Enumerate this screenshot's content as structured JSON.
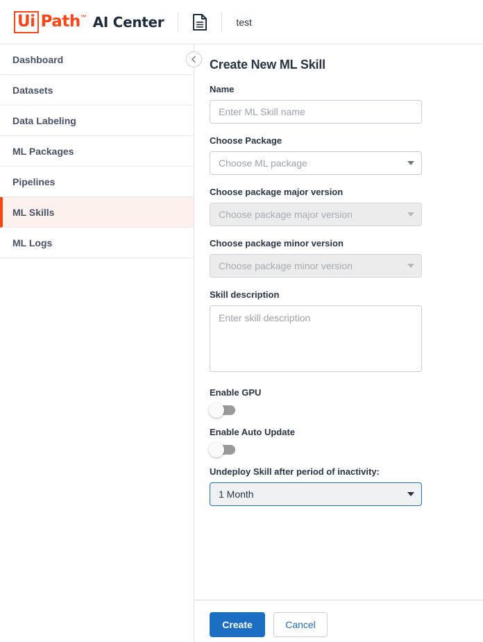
{
  "header": {
    "logo_ui": "Ui",
    "logo_path": "Path",
    "logo_tm": "™",
    "app_name": "AI Center",
    "doc_icon": "document-icon",
    "project_name": "test"
  },
  "sidebar": {
    "items": [
      {
        "label": "Dashboard",
        "active": false
      },
      {
        "label": "Datasets",
        "active": false
      },
      {
        "label": "Data Labeling",
        "active": false
      },
      {
        "label": "ML Packages",
        "active": false
      },
      {
        "label": "Pipelines",
        "active": false
      },
      {
        "label": "ML Skills",
        "active": true
      },
      {
        "label": "ML Logs",
        "active": false
      }
    ],
    "collapse_icon": "chevron-left-icon"
  },
  "main": {
    "title": "Create New ML Skill",
    "fields": {
      "name": {
        "label": "Name",
        "placeholder": "Enter ML Skill name",
        "value": ""
      },
      "package": {
        "label": "Choose Package",
        "placeholder": "Choose ML package",
        "value": ""
      },
      "major_version": {
        "label": "Choose package major version",
        "placeholder": "Choose package major version",
        "value": "",
        "disabled": true
      },
      "minor_version": {
        "label": "Choose package minor version",
        "placeholder": "Choose package minor version",
        "value": "",
        "disabled": true
      },
      "description": {
        "label": "Skill description",
        "placeholder": "Enter skill description",
        "value": ""
      },
      "enable_gpu": {
        "label": "Enable GPU",
        "state": "off"
      },
      "enable_auto_update": {
        "label": "Enable Auto Update",
        "state": "off"
      },
      "undeploy": {
        "label": "Undeploy Skill after period of inactivity:",
        "value": "1 Month"
      }
    },
    "footer": {
      "create_label": "Create",
      "cancel_label": "Cancel"
    }
  },
  "colors": {
    "brand_orange": "#FA4616",
    "primary_blue": "#1b6ec2",
    "active_bg": "#fdf1ed",
    "text_dark": "#273444"
  }
}
